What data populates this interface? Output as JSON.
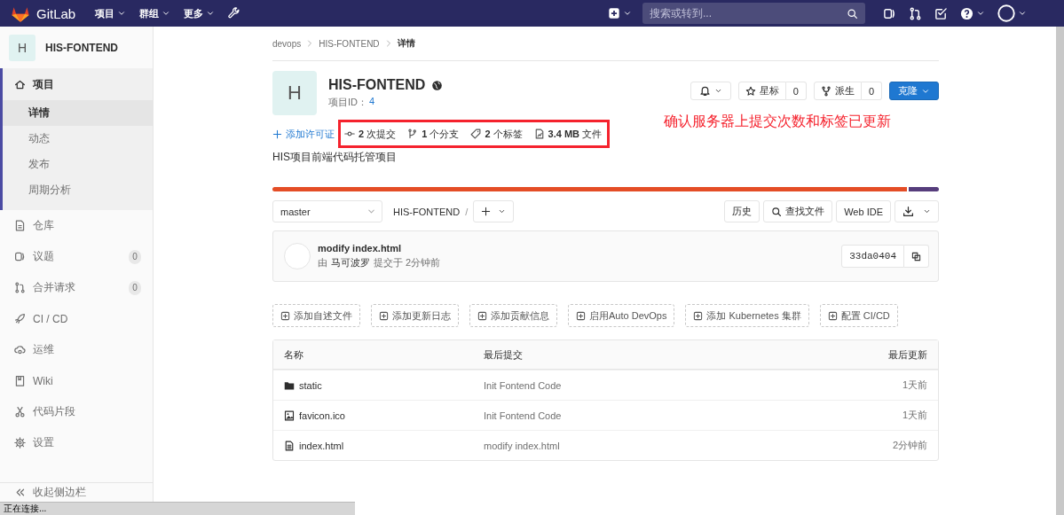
{
  "nav": {
    "logo_text": "GitLab",
    "menus": [
      {
        "label": "项目"
      },
      {
        "label": "群组"
      },
      {
        "label": "更多"
      }
    ],
    "search": {
      "placeholder": "搜索或转到..."
    }
  },
  "sidebar": {
    "project": {
      "avatar": "H",
      "name": "HIS-FONTEND"
    },
    "items": [
      {
        "label": "项目",
        "selected": true,
        "expanded": true,
        "children": [
          {
            "label": "详情",
            "selected": true
          },
          {
            "label": "动态",
            "selected": false
          },
          {
            "label": "发布",
            "selected": false
          },
          {
            "label": "周期分析",
            "selected": false
          }
        ]
      },
      {
        "label": "仓库",
        "selected": false
      },
      {
        "label": "议题",
        "selected": false,
        "count": "0"
      },
      {
        "label": "合并请求",
        "selected": false,
        "count": "0"
      },
      {
        "label": "CI / CD",
        "selected": false
      },
      {
        "label": "运维",
        "selected": false
      },
      {
        "label": "Wiki",
        "selected": false
      },
      {
        "label": "代码片段",
        "selected": false
      },
      {
        "label": "设置",
        "selected": false
      }
    ],
    "collapse": "收起侧边栏"
  },
  "breadcrumb": [
    "devops",
    "HIS-FONTEND",
    "详情"
  ],
  "project": {
    "avatar": "H",
    "name": "HIS-FONTEND",
    "id_label": "项目ID：",
    "id": "4",
    "star": {
      "label": "星标",
      "count": "0"
    },
    "fork": {
      "label": "派生",
      "count": "0"
    },
    "clone": "克隆",
    "license_link": "添加许可证",
    "stats": [
      "**2** 次提交",
      "**1** 个分支",
      "**2** 个标签",
      "**3.4 MB** 文件"
    ],
    "description": "HIS项目前端代码托管项目",
    "languages": [
      {
        "level": 0.955,
        "color": "#e44d26"
      },
      {
        "level": 0.045,
        "color": "#563d7c"
      }
    ]
  },
  "annotation": "确认服务器上提交次数和标签已更新",
  "tree_controls": {
    "branch": "master",
    "path": "HIS-FONTEND",
    "separator": "/",
    "buttons": [
      "历史",
      "查找文件",
      "Web IDE"
    ]
  },
  "last_commit": {
    "title": "modify index.html",
    "prefix": "由",
    "author": "马可波罗",
    "suffix": "提交于 2分钟前",
    "sha": "33da0404"
  },
  "suggestions": [
    "添加自述文件",
    "添加更新日志",
    "添加贡献信息",
    "启用Auto DevOps",
    "添加 Kubernetes 集群",
    "配置 CI/CD"
  ],
  "files": {
    "columns": [
      "名称",
      "最后提交",
      "最后更新"
    ],
    "rows": [
      {
        "kind": "folder",
        "name": "static",
        "commit": "Init Fontend Code",
        "updated": "1天前"
      },
      {
        "kind": "image",
        "name": "favicon.ico",
        "commit": "Init Fontend Code",
        "updated": "1天前"
      },
      {
        "kind": "file",
        "name": "index.html",
        "commit": "modify index.html",
        "updated": "2分钟前"
      }
    ]
  },
  "status_bar": "正在连接..."
}
